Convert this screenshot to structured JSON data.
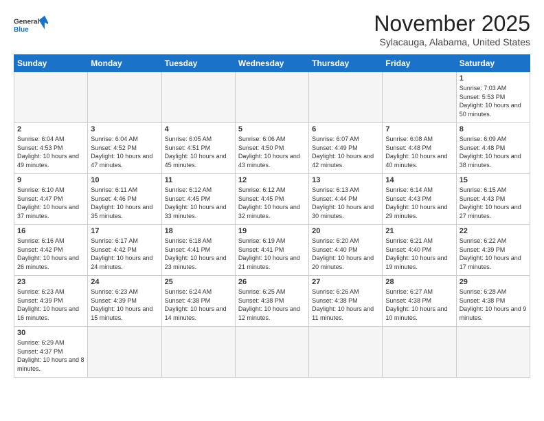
{
  "header": {
    "logo": {
      "general": "General",
      "blue": "Blue"
    },
    "title": "November 2025",
    "location": "Sylacauga, Alabama, United States"
  },
  "weekdays": [
    "Sunday",
    "Monday",
    "Tuesday",
    "Wednesday",
    "Thursday",
    "Friday",
    "Saturday"
  ],
  "weeks": [
    [
      {
        "day": "",
        "info": ""
      },
      {
        "day": "",
        "info": ""
      },
      {
        "day": "",
        "info": ""
      },
      {
        "day": "",
        "info": ""
      },
      {
        "day": "",
        "info": ""
      },
      {
        "day": "",
        "info": ""
      },
      {
        "day": "1",
        "info": "Sunrise: 7:03 AM\nSunset: 5:53 PM\nDaylight: 10 hours\nand 50 minutes."
      }
    ],
    [
      {
        "day": "2",
        "info": "Sunrise: 6:04 AM\nSunset: 4:53 PM\nDaylight: 10 hours\nand 49 minutes."
      },
      {
        "day": "3",
        "info": "Sunrise: 6:04 AM\nSunset: 4:52 PM\nDaylight: 10 hours\nand 47 minutes."
      },
      {
        "day": "4",
        "info": "Sunrise: 6:05 AM\nSunset: 4:51 PM\nDaylight: 10 hours\nand 45 minutes."
      },
      {
        "day": "5",
        "info": "Sunrise: 6:06 AM\nSunset: 4:50 PM\nDaylight: 10 hours\nand 43 minutes."
      },
      {
        "day": "6",
        "info": "Sunrise: 6:07 AM\nSunset: 4:49 PM\nDaylight: 10 hours\nand 42 minutes."
      },
      {
        "day": "7",
        "info": "Sunrise: 6:08 AM\nSunset: 4:48 PM\nDaylight: 10 hours\nand 40 minutes."
      },
      {
        "day": "8",
        "info": "Sunrise: 6:09 AM\nSunset: 4:48 PM\nDaylight: 10 hours\nand 38 minutes."
      }
    ],
    [
      {
        "day": "9",
        "info": "Sunrise: 6:10 AM\nSunset: 4:47 PM\nDaylight: 10 hours\nand 37 minutes."
      },
      {
        "day": "10",
        "info": "Sunrise: 6:11 AM\nSunset: 4:46 PM\nDaylight: 10 hours\nand 35 minutes."
      },
      {
        "day": "11",
        "info": "Sunrise: 6:12 AM\nSunset: 4:45 PM\nDaylight: 10 hours\nand 33 minutes."
      },
      {
        "day": "12",
        "info": "Sunrise: 6:12 AM\nSunset: 4:45 PM\nDaylight: 10 hours\nand 32 minutes."
      },
      {
        "day": "13",
        "info": "Sunrise: 6:13 AM\nSunset: 4:44 PM\nDaylight: 10 hours\nand 30 minutes."
      },
      {
        "day": "14",
        "info": "Sunrise: 6:14 AM\nSunset: 4:43 PM\nDaylight: 10 hours\nand 29 minutes."
      },
      {
        "day": "15",
        "info": "Sunrise: 6:15 AM\nSunset: 4:43 PM\nDaylight: 10 hours\nand 27 minutes."
      }
    ],
    [
      {
        "day": "16",
        "info": "Sunrise: 6:16 AM\nSunset: 4:42 PM\nDaylight: 10 hours\nand 26 minutes."
      },
      {
        "day": "17",
        "info": "Sunrise: 6:17 AM\nSunset: 4:42 PM\nDaylight: 10 hours\nand 24 minutes."
      },
      {
        "day": "18",
        "info": "Sunrise: 6:18 AM\nSunset: 4:41 PM\nDaylight: 10 hours\nand 23 minutes."
      },
      {
        "day": "19",
        "info": "Sunrise: 6:19 AM\nSunset: 4:41 PM\nDaylight: 10 hours\nand 21 minutes."
      },
      {
        "day": "20",
        "info": "Sunrise: 6:20 AM\nSunset: 4:40 PM\nDaylight: 10 hours\nand 20 minutes."
      },
      {
        "day": "21",
        "info": "Sunrise: 6:21 AM\nSunset: 4:40 PM\nDaylight: 10 hours\nand 19 minutes."
      },
      {
        "day": "22",
        "info": "Sunrise: 6:22 AM\nSunset: 4:39 PM\nDaylight: 10 hours\nand 17 minutes."
      }
    ],
    [
      {
        "day": "23",
        "info": "Sunrise: 6:23 AM\nSunset: 4:39 PM\nDaylight: 10 hours\nand 16 minutes."
      },
      {
        "day": "24",
        "info": "Sunrise: 6:23 AM\nSunset: 4:39 PM\nDaylight: 10 hours\nand 15 minutes."
      },
      {
        "day": "25",
        "info": "Sunrise: 6:24 AM\nSunset: 4:38 PM\nDaylight: 10 hours\nand 14 minutes."
      },
      {
        "day": "26",
        "info": "Sunrise: 6:25 AM\nSunset: 4:38 PM\nDaylight: 10 hours\nand 12 minutes."
      },
      {
        "day": "27",
        "info": "Sunrise: 6:26 AM\nSunset: 4:38 PM\nDaylight: 10 hours\nand 11 minutes."
      },
      {
        "day": "28",
        "info": "Sunrise: 6:27 AM\nSunset: 4:38 PM\nDaylight: 10 hours\nand 10 minutes."
      },
      {
        "day": "29",
        "info": "Sunrise: 6:28 AM\nSunset: 4:38 PM\nDaylight: 10 hours\nand 9 minutes."
      }
    ],
    [
      {
        "day": "30",
        "info": "Sunrise: 6:29 AM\nSunset: 4:37 PM\nDaylight: 10 hours\nand 8 minutes."
      },
      {
        "day": "",
        "info": ""
      },
      {
        "day": "",
        "info": ""
      },
      {
        "day": "",
        "info": ""
      },
      {
        "day": "",
        "info": ""
      },
      {
        "day": "",
        "info": ""
      },
      {
        "day": "",
        "info": ""
      }
    ]
  ],
  "colors": {
    "header_bg": "#1a73c8",
    "border": "#cccccc",
    "empty_bg": "#f5f5f5"
  }
}
